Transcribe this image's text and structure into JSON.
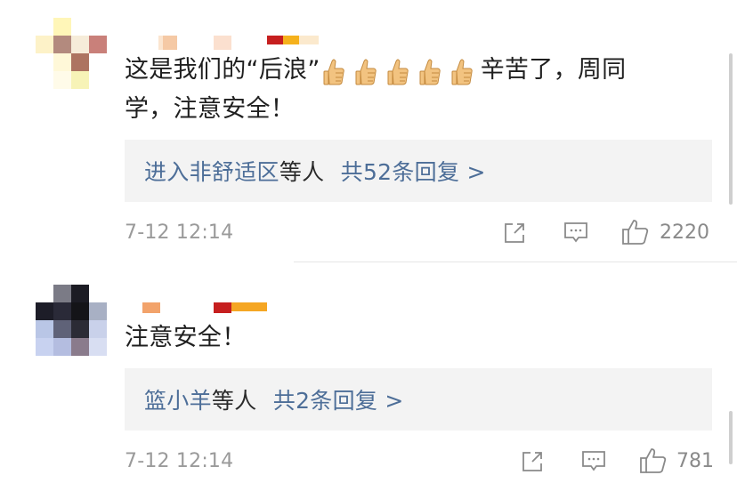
{
  "comments": [
    {
      "text_before": "这是我们的“后浪”",
      "emoji": "thumbs-up-icon",
      "text_after": "辛苦了，周同",
      "text_line2": "学，注意安全！",
      "replies": {
        "names": "进入非舒适区",
        "suffix": "等人",
        "count": "共52条回复 >"
      },
      "time": "7-12 12:14",
      "likes": "2220"
    },
    {
      "text": "注意安全！",
      "replies": {
        "names": "篮小羊",
        "suffix": "等人",
        "count": "共2条回复 >"
      },
      "time": "7-12 12:14",
      "likes": "781"
    }
  ]
}
